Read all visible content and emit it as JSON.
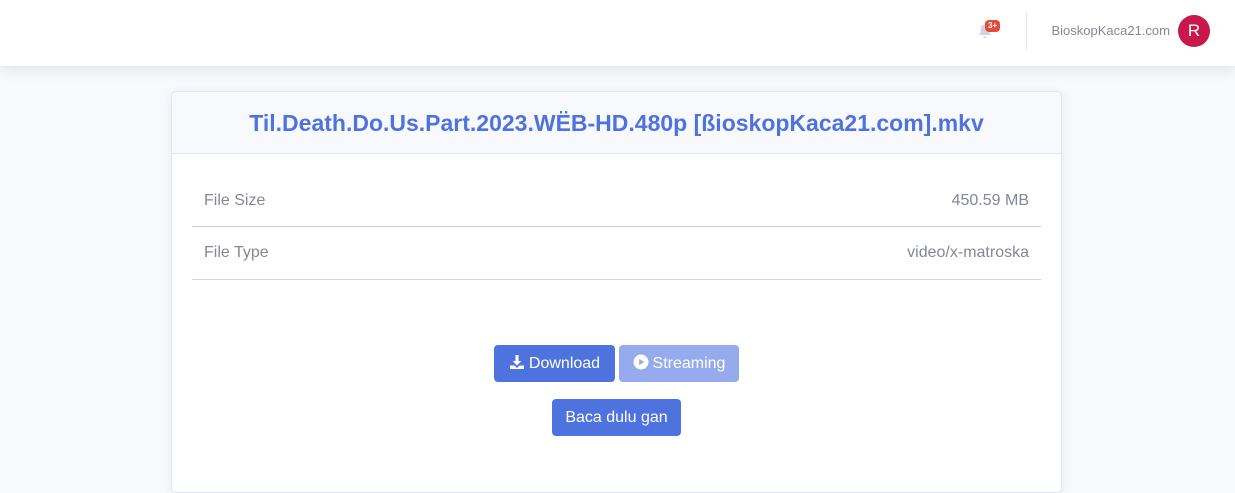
{
  "topbar": {
    "notification_badge": "3+",
    "username": "BioskopKaca21.com",
    "avatar_initial": "R"
  },
  "file": {
    "title": "Til.Death.Do.Us.Part.2023.WËB-HD.480p [ßioskopKaca21.com].mkv",
    "details": [
      {
        "label": "File Size",
        "value": "450.59 MB"
      },
      {
        "label": "File Type",
        "value": "video/x-matroska"
      }
    ]
  },
  "actions": {
    "download_label": "Download",
    "streaming_label": "Streaming",
    "read_label": "Baca dulu gan"
  },
  "colors": {
    "primary": "#4e73df",
    "primary_disabled": "#95abee",
    "avatar": "#c8174b",
    "badge": "#e74a3b"
  }
}
